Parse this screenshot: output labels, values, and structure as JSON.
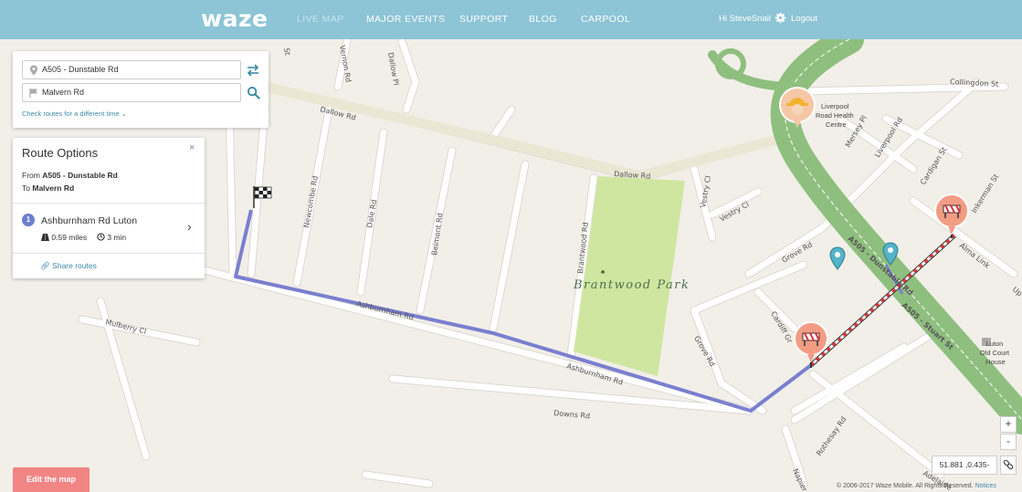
{
  "header": {
    "logo": "waze",
    "nav": [
      "LIVE MAP",
      "MAJOR EVENTS",
      "SUPPORT",
      "BLOG",
      "CARPOOL"
    ],
    "greeting": "Hi SteveSnail",
    "logout": "Logout"
  },
  "search": {
    "from_value": "A505 - Dunstable Rd",
    "to_value": "Malvern Rd",
    "different_time": "Check routes for a different time"
  },
  "route_options": {
    "title": "Route Options",
    "from_label": "From",
    "from": "A505 - Dunstable Rd",
    "to_label": "To",
    "to": "Malvern Rd",
    "routes": [
      {
        "number": "1",
        "name": "Ashburnham Rd Luton",
        "distance": "0.59 miles",
        "time": "3 min"
      }
    ],
    "share": "Share routes"
  },
  "map": {
    "streets": {
      "dallow_rd_1": "Dallow Rd",
      "dallow_rd_2": "Dallow Rd",
      "dallow_pl": "Dallow Pl",
      "vernon_rd": "Vernon Rd",
      "newcombe_rd": "Newcombe Rd",
      "dale_rd": "Dale Rd",
      "belmont_rd": "Belmont Rd",
      "brantwood_rd": "Brantwood Rd",
      "mulberry_cl": "Mulberry Cl",
      "downs_rd": "Downs Rd",
      "collingdon_st": "Collingdon St",
      "mersey_pl": "Mersey Pl",
      "liverpool_rd": "Liverpool Rd",
      "cardigan_st": "Cardigan St",
      "inkerman_st": "Inkerman St",
      "vestry_cl_1": "Vestry Cl",
      "vestry_cl_2": "Vestry Cl",
      "grove_rd_1": "Grove Rd",
      "grove_rd_2": "Grove Rd",
      "cardiff_gr": "Cardiff Gr",
      "a505": "A505 - Dunstable Rd",
      "a505_stuart": "A505 - Stuart St",
      "alma_link": "Alma Link",
      "up": "Up",
      "rothesay_rd": "Rothesay Rd",
      "napier": "Napier",
      "adelaide": "Adelaide",
      "ashburnham_1": "Ashburnham Rd",
      "ashburnham_2": "Ashburnham Rd",
      "st": "St"
    },
    "park_name": "Brantwood Park",
    "poi_liverpool": "Liverpool Road Health Centre",
    "poi_court": "Luton Old Court House"
  },
  "controls": {
    "edit_map": "Edit the map",
    "zoom_in": "+",
    "zoom_out": "-",
    "coords": "51.881 ,0.435-",
    "copyright": "© 2006-2017 Waze Mobile. All Rights Reserved.",
    "notices": "Notices"
  },
  "colors": {
    "header": "#8dc4d6",
    "route": "#7a7fcf",
    "highway": "#8fbf7f",
    "park": "#cfe6a1",
    "closure": "#e0333a",
    "edit_button": "#f08584"
  }
}
